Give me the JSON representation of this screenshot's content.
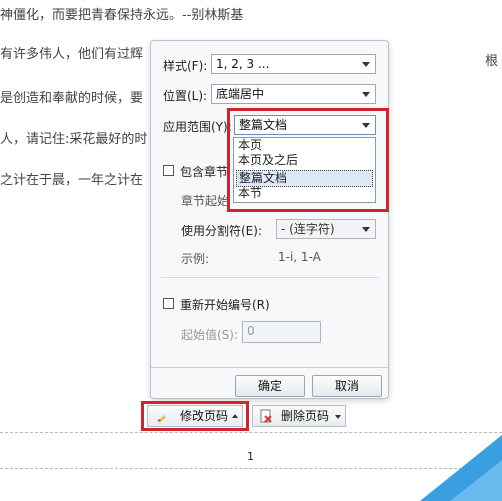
{
  "document": {
    "lines": [
      "神僵化，而要把青春保持永远。--别林斯基",
      "有许多伟人，他们有过辉",
      "是创造和奉献的时候，要",
      "人，请记住:采花最好的时",
      "之计在于晨，一年之计在"
    ],
    "page_number": "1"
  },
  "dialog": {
    "style_label": "样式(F):",
    "style_value": "1, 2, 3 ...",
    "position_label": "位置(L):",
    "position_value": "底端居中",
    "scope_label": "应用范围(Y):",
    "scope_value": "整篇文档",
    "include_chapter_label": "包含章节",
    "chapter_start_label": "章节起始",
    "separator_label": "使用分割符(E):",
    "separator_value": "-    (连字符)",
    "example_label": "示例:",
    "example_value": "1-i, 1-A",
    "restart_label": "重新开始编号(R)",
    "start_value_label": "起始值(S):",
    "start_value": "0",
    "ok_label": "确定",
    "cancel_label": "取消"
  },
  "dropdown": {
    "options": [
      "本页",
      "本页及之后",
      "整篇文档",
      "本节"
    ],
    "selected": "整篇文档"
  },
  "toolbar": {
    "modify_label": "修改页码",
    "delete_label": "删除页码"
  },
  "colors": {
    "highlight": "#d4232e",
    "dialog_bg": "#f7f8fa"
  }
}
